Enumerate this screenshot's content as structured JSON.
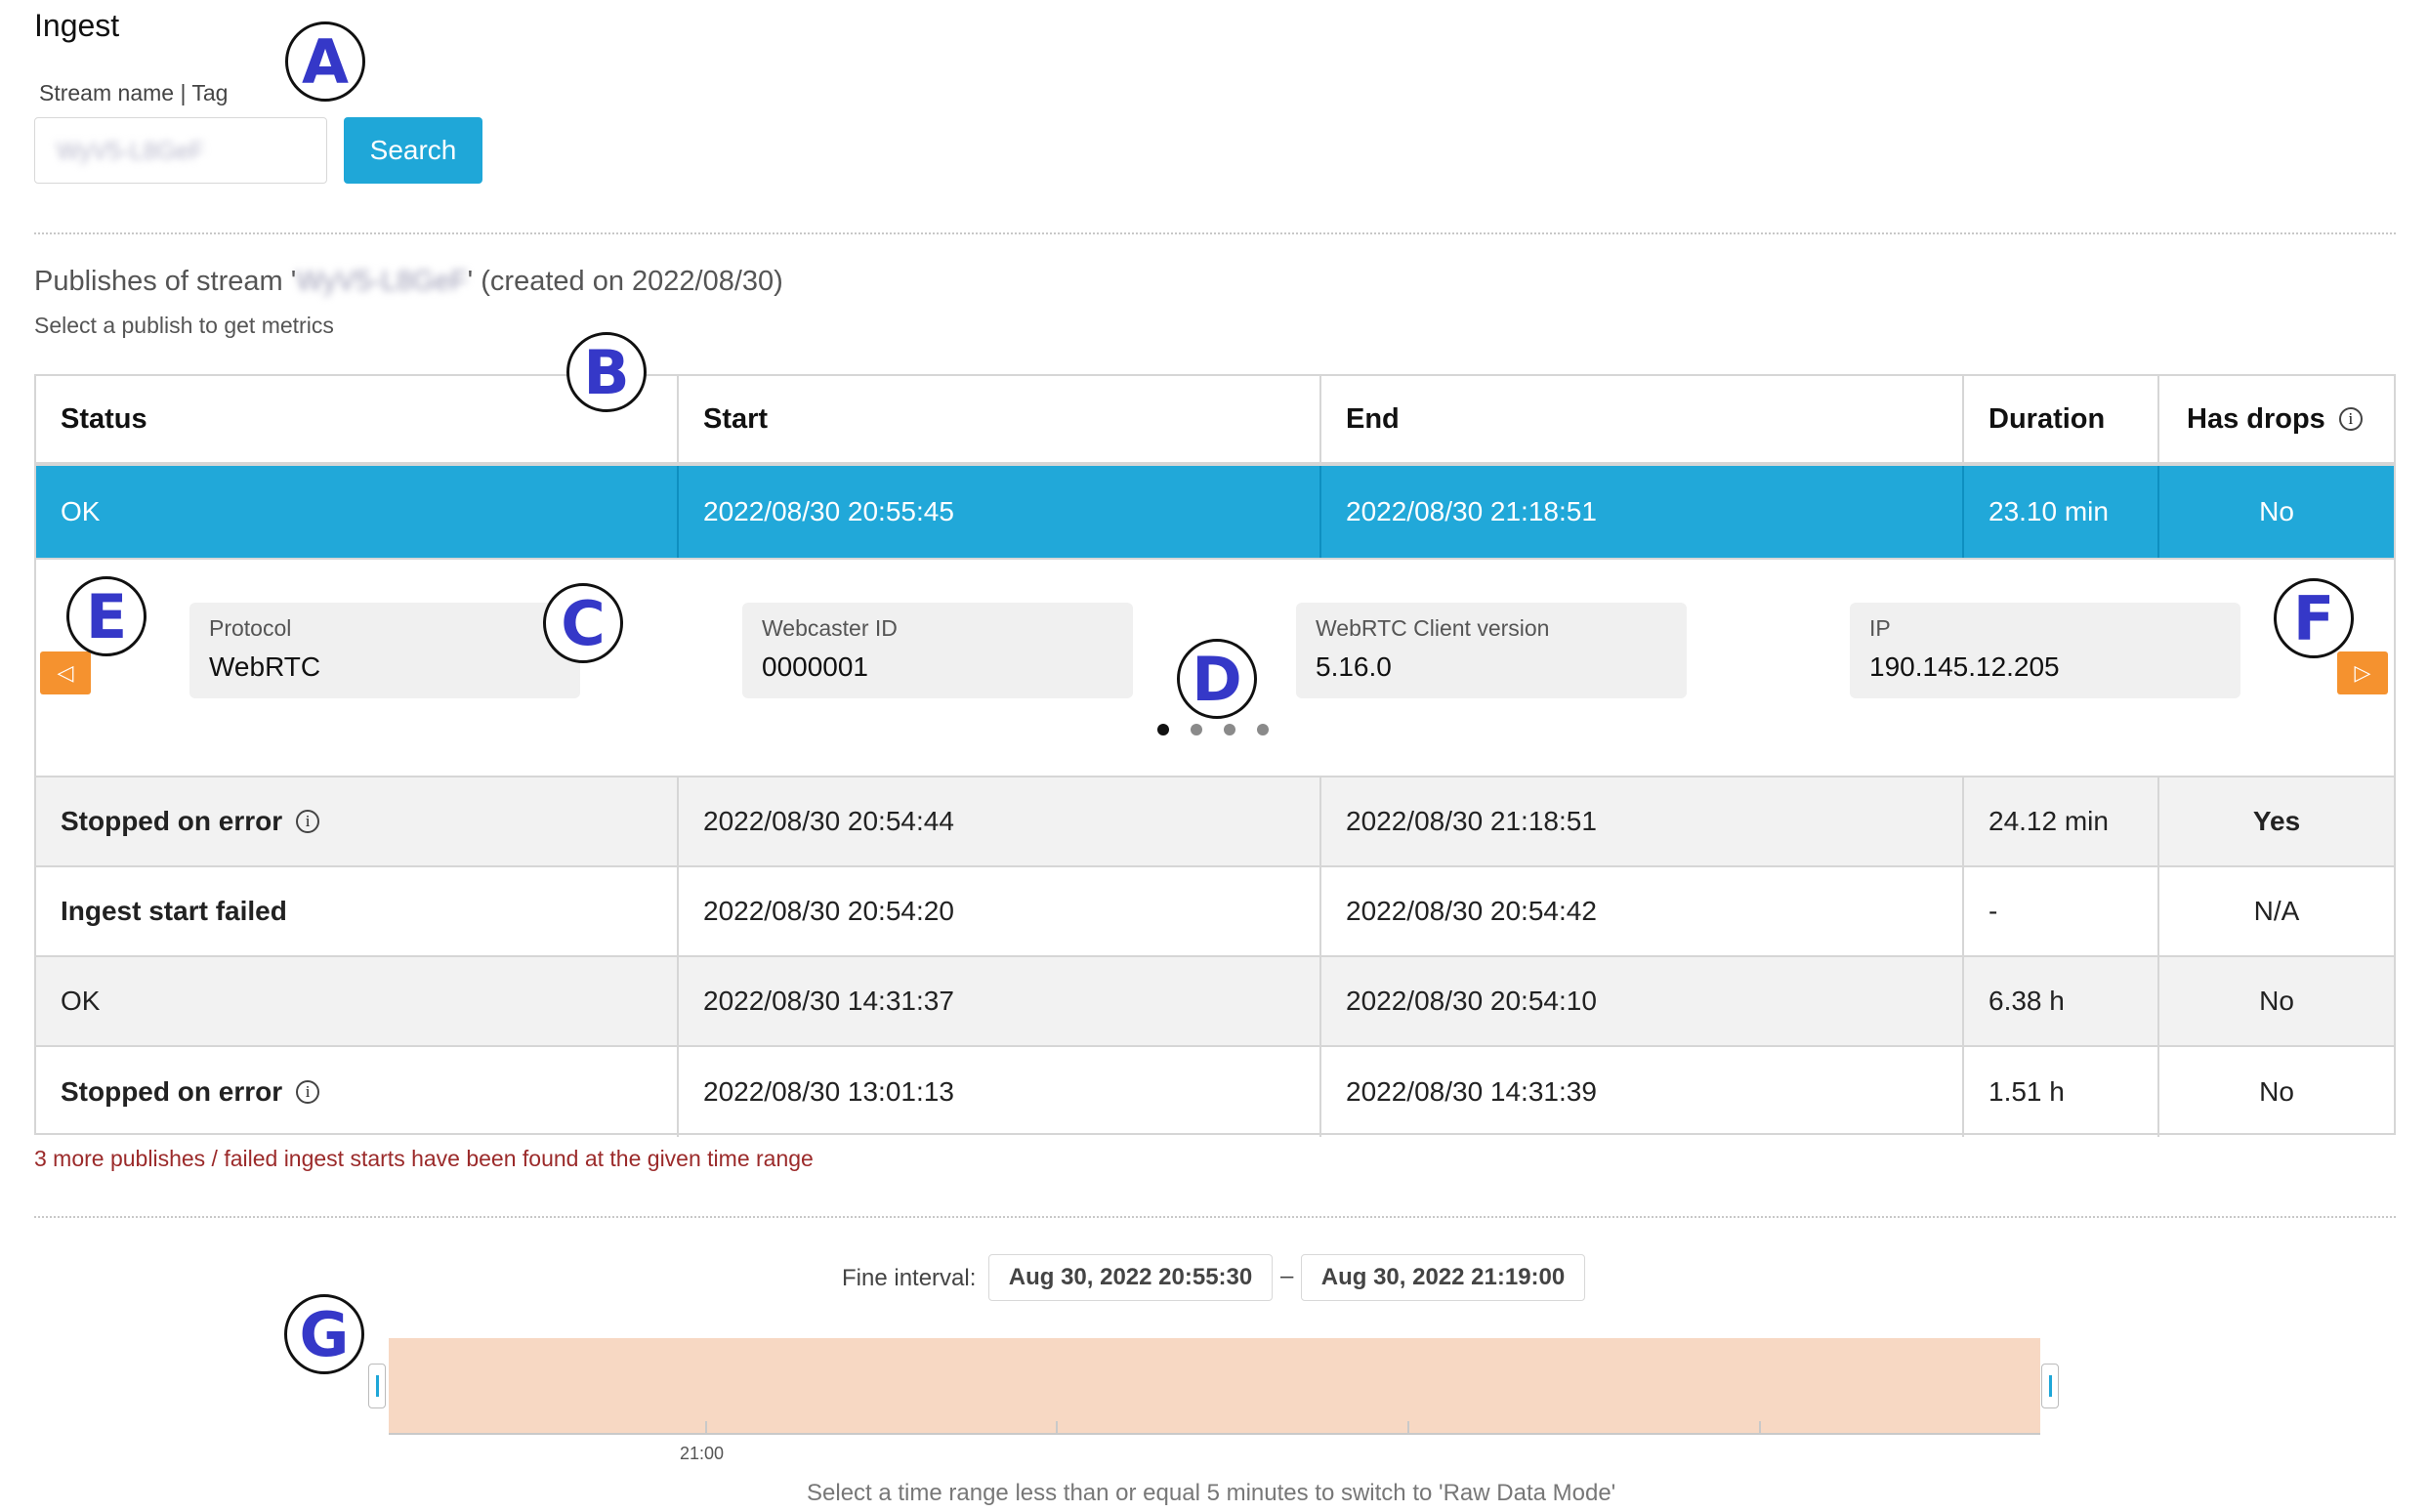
{
  "page": {
    "title": "Ingest"
  },
  "search": {
    "label": "Stream name | Tag",
    "value": "WyV5-L8GeF",
    "button": "Search"
  },
  "publishes": {
    "title_prefix": "Publishes of stream '",
    "stream_name": "WyV5-L8GeF",
    "title_suffix": "' (created on 2022/08/30)",
    "subtitle": "Select a publish to get metrics",
    "columns": [
      "Status",
      "Start",
      "End",
      "Duration",
      "Has drops"
    ],
    "selected_row": {
      "status": "OK",
      "start": "2022/08/30 20:55:45",
      "end": "2022/08/30 21:18:51",
      "duration": "23.10 min",
      "has_drops": "No"
    },
    "details": [
      {
        "label": "Protocol",
        "value": "WebRTC"
      },
      {
        "label": "Webcaster ID",
        "value": "0000001"
      },
      {
        "label": "WebRTC Client version",
        "value": "5.16.0"
      },
      {
        "label": "IP",
        "value": "190.145.12.205"
      }
    ],
    "carousel": {
      "pages": 4,
      "active": 1
    },
    "rows": [
      {
        "status": "Stopped on error",
        "start": "2022/08/30 20:54:44",
        "end": "2022/08/30 21:18:51",
        "duration": "24.12 min",
        "has_drops": "Yes"
      },
      {
        "status": "Ingest start failed",
        "start": "2022/08/30 20:54:20",
        "end": "2022/08/30 20:54:42",
        "duration": "-",
        "has_drops": "N/A"
      },
      {
        "status": "OK",
        "start": "2022/08/30 14:31:37",
        "end": "2022/08/30 20:54:10",
        "duration": "6.38 h",
        "has_drops": "No"
      },
      {
        "status": "Stopped on error",
        "start": "2022/08/30 13:01:13",
        "end": "2022/08/30 14:31:39",
        "duration": "1.51 h",
        "has_drops": "No"
      }
    ],
    "more_note": "3 more publishes / failed ingest starts have been found at the given time range"
  },
  "interval": {
    "label": "Fine interval:",
    "from": "Aug 30, 2022 20:55:30",
    "separator": "–",
    "to": "Aug 30, 2022 21:19:00",
    "tick_label": "21:00",
    "hint": "Select a time range less than or equal 5 minutes to switch to 'Raw Data Mode'"
  },
  "annotations": [
    "A",
    "B",
    "C",
    "D",
    "E",
    "F",
    "G"
  ],
  "colors": {
    "accent": "#1fa7d8",
    "arrow": "#f5922f",
    "range": "#f7d8c3",
    "note": "#9b2a2a",
    "marker": "#3538c8"
  },
  "icons": {
    "info": "info-icon",
    "prev": "caret-left-icon",
    "next": "caret-right-icon"
  }
}
